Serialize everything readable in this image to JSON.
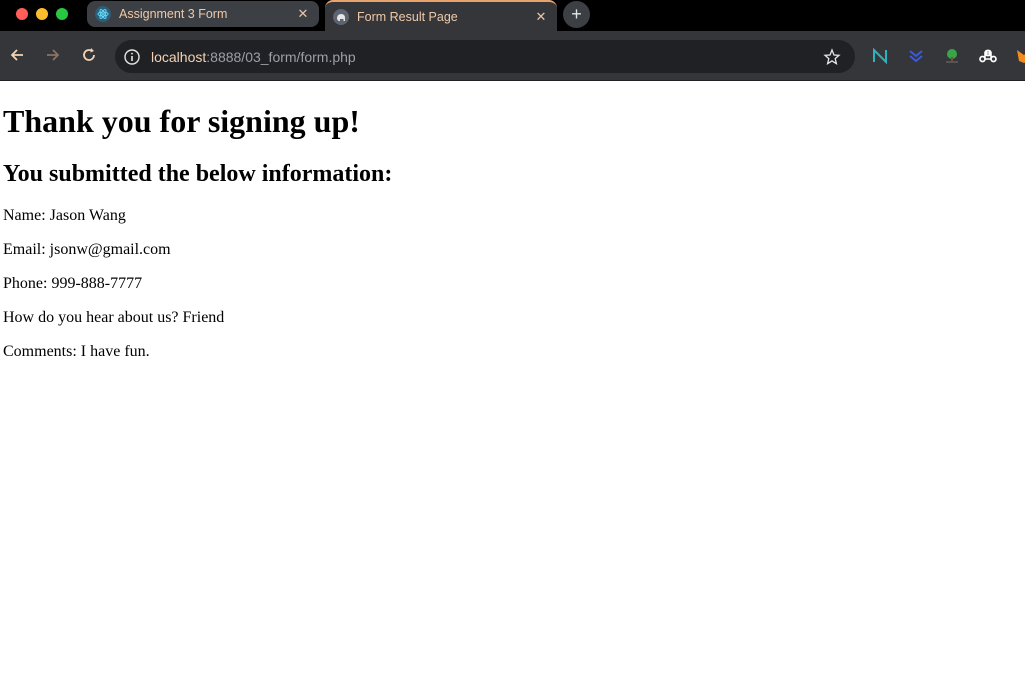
{
  "browser": {
    "tabs": [
      {
        "title": "Assignment 3 Form",
        "favicon": "react-icon",
        "active": false
      },
      {
        "title": "Form Result Page",
        "favicon": "elephant-icon",
        "active": true
      }
    ],
    "close_glyph": "✕",
    "new_tab_glyph": "+",
    "url_host": "localhost",
    "url_path": ":8888/03_form/form.php"
  },
  "page": {
    "heading": "Thank you for signing up!",
    "subheading": "You submitted the below information:",
    "fields": [
      {
        "text": "Name: Jason Wang"
      },
      {
        "text": "Email: jsonw@gmail.com"
      },
      {
        "text": "Phone: 999-888-7777"
      },
      {
        "text": "How do you hear about us? Friend"
      },
      {
        "text": "Comments: I have fun."
      }
    ]
  },
  "colors": {
    "tab_text": "#f0c9a8",
    "toolbar_bg": "#35363a",
    "omnibox_bg": "#202124",
    "accent": "#e8a36c"
  }
}
